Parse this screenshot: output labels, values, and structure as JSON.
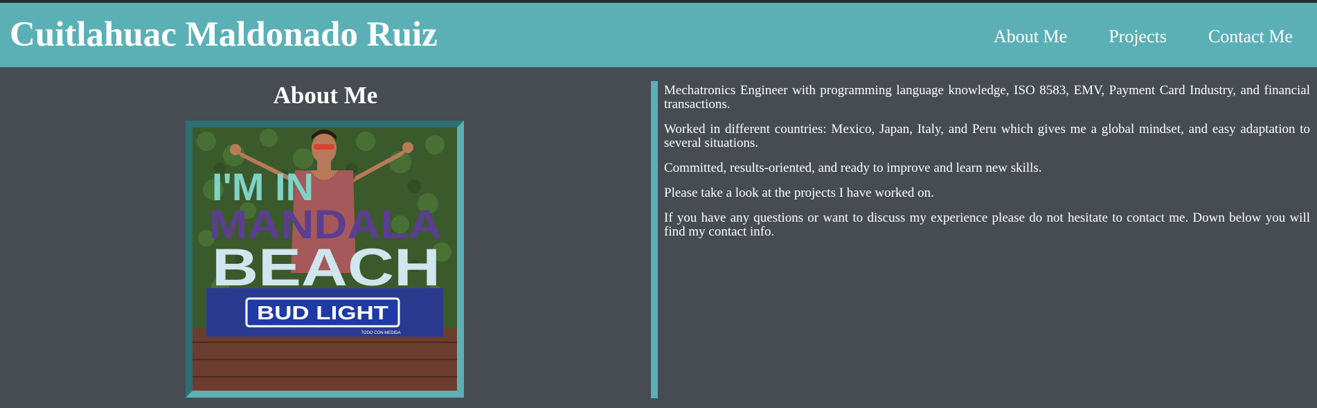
{
  "header": {
    "site_title": "Cuitlahuac Maldonado Ruiz",
    "nav": [
      {
        "label": "About Me"
      },
      {
        "label": "Projects"
      },
      {
        "label": "Contact Me"
      }
    ]
  },
  "about": {
    "title": "About Me",
    "photo": {
      "sign_line1": "I'M IN",
      "sign_line2": "MANDALA",
      "sign_line3": "BEACH",
      "sign_badge": "BUD LIGHT",
      "sign_tagline": "TODO CON MEDIDA"
    },
    "paragraphs": [
      "Mechatronics Engineer with programming language knowledge, ISO 8583, EMV, Payment Card Industry, and financial transactions.",
      "Worked in different countries: Mexico, Japan, Italy, and Peru which gives me a global mindset, and easy adaptation to several situations.",
      "Committed, results-oriented, and ready to improve and learn new skills.",
      "Please take a look at the projects I have worked on.",
      "If you have any questions or want to discuss my experience please do not hesitate to contact me. Down below you will find my contact info."
    ]
  },
  "colors": {
    "accent": "#5bb0b6",
    "background": "#474b52",
    "text": "#ffffff"
  }
}
